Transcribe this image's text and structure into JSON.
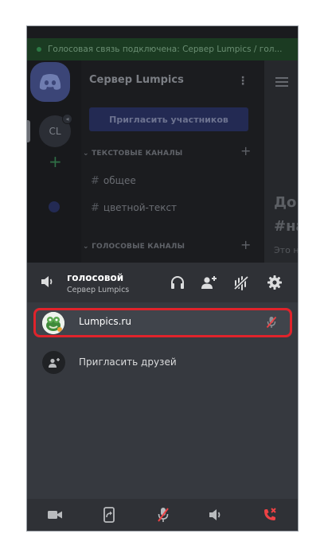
{
  "background": {
    "banner_text": "Голосовая связь подключена: Сервер Lumpics / гол...",
    "server_name": "Сервер Lumpics",
    "invite_button": "Пригласить участников",
    "guild_initials": "CL",
    "text_category": "ТЕКСТОВЫЕ КАНАЛЫ",
    "text_channels": [
      "общее",
      "цветной-текст"
    ],
    "voice_category": "ГОЛОСОВЫЕ КАНАЛЫ",
    "right_heading_1": "До",
    "right_heading_2": "#на",
    "right_subtext": "Это н"
  },
  "voice": {
    "channel_name": "голосовой",
    "server_name": "Сервер Lumpics"
  },
  "participants": [
    {
      "name": "Lumpics.ru",
      "muted": true
    }
  ],
  "invite_friends_label": "Пригласить друзей",
  "icons": {
    "header": [
      "speaker-icon",
      "headphones-icon",
      "add-user-icon",
      "noise-suppression-icon",
      "gear-icon"
    ],
    "bottom": [
      "camera-icon",
      "screen-share-icon",
      "microphone-muted-icon",
      "speaker-icon",
      "disconnect-call-icon"
    ]
  },
  "colors": {
    "highlight_outline": "#e0232b",
    "disconnect": "#ed4245",
    "muted": "#ed4245"
  }
}
